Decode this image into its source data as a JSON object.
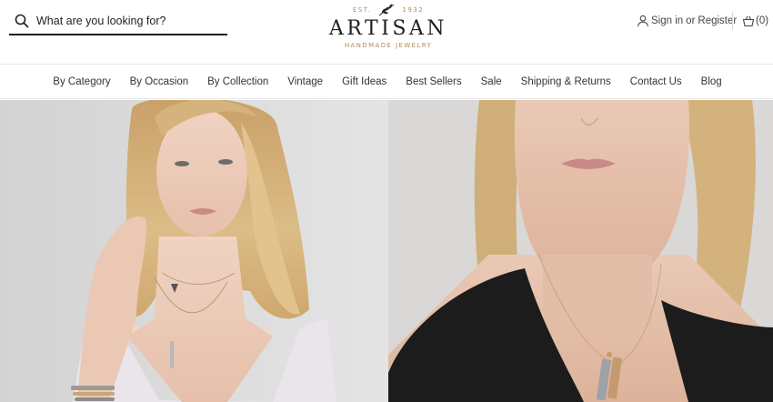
{
  "search": {
    "placeholder": "What are you looking for?"
  },
  "logo": {
    "est_left": "EST.",
    "est_right": "1932",
    "wordmark": "ARTISAN",
    "tagline": "HANDMADE JEWELRY"
  },
  "account": {
    "sign_in": "Sign in",
    "or": "or",
    "register": "Register"
  },
  "cart": {
    "count_label": "(0)"
  },
  "nav": {
    "items": [
      {
        "label": "By Category"
      },
      {
        "label": "By Occasion"
      },
      {
        "label": "By Collection"
      },
      {
        "label": "Vintage"
      },
      {
        "label": "Gift Ideas"
      },
      {
        "label": "Best Sellers"
      },
      {
        "label": "Sale"
      },
      {
        "label": "Shipping & Returns"
      },
      {
        "label": "Contact Us"
      },
      {
        "label": "Blog"
      }
    ]
  },
  "colors": {
    "accent_gold": "#b88a57",
    "text_dark": "#1f1f1f"
  },
  "icons": [
    "search-icon",
    "leaf-icon",
    "user-icon",
    "bag-icon"
  ]
}
